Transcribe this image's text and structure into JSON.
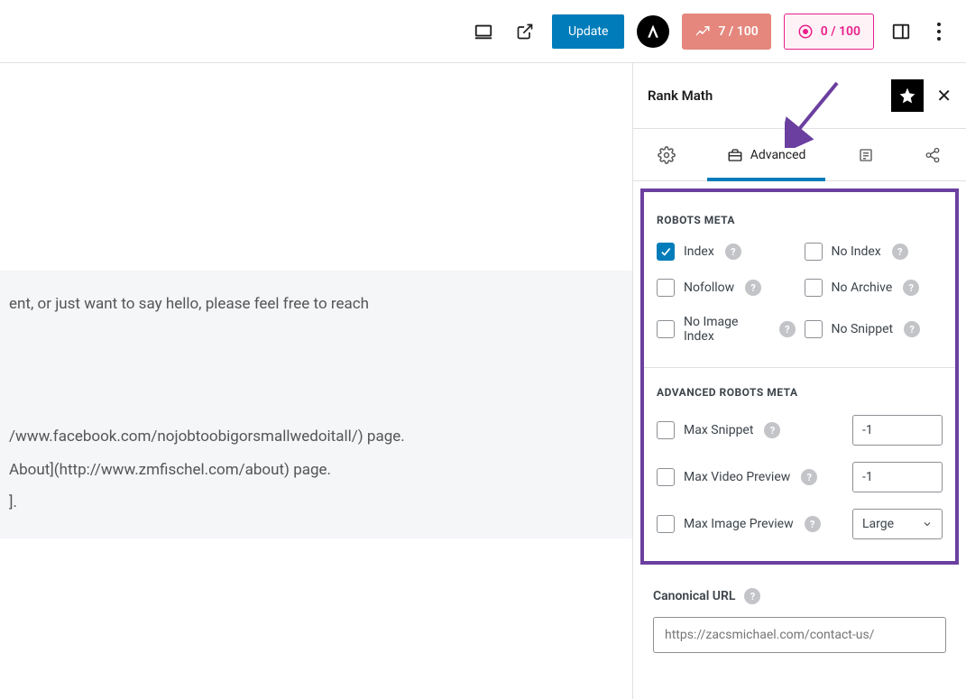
{
  "topbar": {
    "update_label": "Update",
    "score1": "7 / 100",
    "score2": "0 / 100"
  },
  "sidebar": {
    "title": "Rank Math",
    "tabs": {
      "advanced": "Advanced"
    },
    "robots_meta_heading": "ROBOTS META",
    "robots": {
      "index": "Index",
      "noindex": "No Index",
      "nofollow": "Nofollow",
      "noarchive": "No Archive",
      "noimageindex": "No Image Index",
      "nosnippet": "No Snippet"
    },
    "adv_robots_heading": "ADVANCED ROBOTS META",
    "adv": {
      "max_snippet": "Max Snippet",
      "max_snippet_val": "-1",
      "max_video": "Max Video Preview",
      "max_video_val": "-1",
      "max_image": "Max Image Preview",
      "max_image_val": "Large"
    },
    "canonical": {
      "title": "Canonical URL",
      "placeholder": "https://zacsmichael.com/contact-us/"
    }
  },
  "content": {
    "line1": "ent, or just want to say hello, please feel free to reach",
    "line2": "",
    "line3": "",
    "line4": "",
    "line5": "/www.facebook.com/nojobtoobigorsmallwedoitall/) page.",
    "line6": "About](http://www.zmfischel.com/about) page.",
    "line7": "]."
  }
}
